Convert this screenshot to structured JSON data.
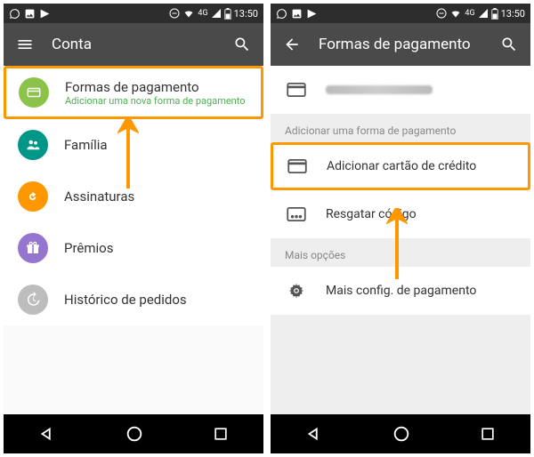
{
  "status": {
    "time": "13:50",
    "network": "4G"
  },
  "left": {
    "title": "Conta",
    "items": [
      {
        "title": "Formas de pagamento",
        "sub": "Adicionar uma nova forma de pagamento"
      },
      {
        "title": "Família"
      },
      {
        "title": "Assinaturas"
      },
      {
        "title": "Prêmios"
      },
      {
        "title": "Histórico de pedidos"
      }
    ]
  },
  "right": {
    "title": "Formas de pagamento",
    "section1": "Adicionar uma forma de pagamento",
    "addCard": "Adicionar cartão de crédito",
    "redeem": "Resgatar código",
    "section2": "Mais opções",
    "more": "Mais config. de pagamento"
  }
}
